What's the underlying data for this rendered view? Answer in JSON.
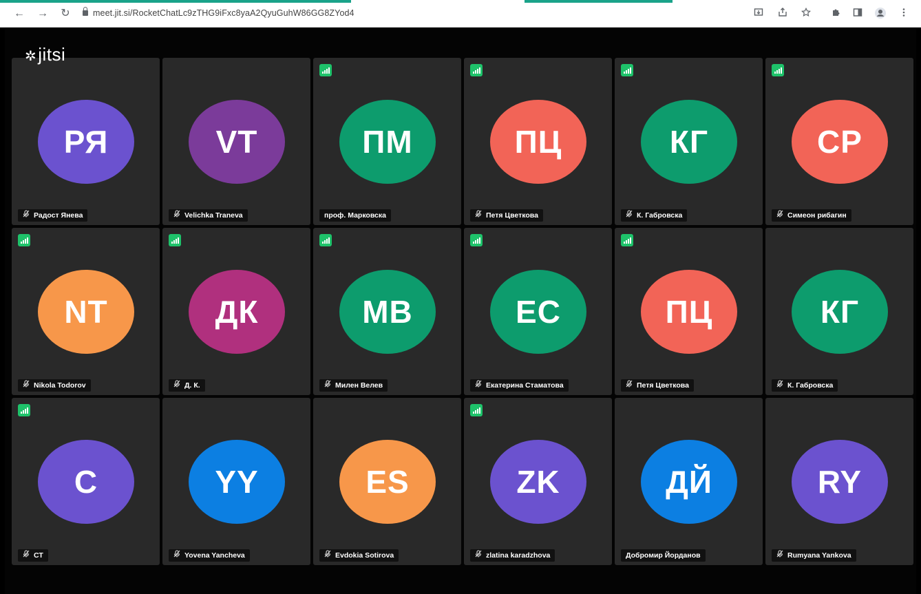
{
  "browser": {
    "url": "meet.jit.si/RocketChatLc9zTHG9iFxc8yaA2QyuGuhW86GG8ZYod4",
    "back_glyph": "←",
    "forward_glyph": "→",
    "reload_glyph": "↻"
  },
  "app": {
    "logo_text": "jitsi"
  },
  "colors": {
    "purple": "#6b52cf",
    "violet": "#7b3b9a",
    "green": "#0d9c6d",
    "coral": "#f26457",
    "orange": "#f7974a",
    "magenta": "#b0307e",
    "blue": "#0c7fe2",
    "connection": "#1ec26a"
  },
  "participants": [
    {
      "initials": "РЯ",
      "name": "Радост Янева",
      "color": "#6b52cf",
      "muted": true,
      "indicator": false
    },
    {
      "initials": "VT",
      "name": "Velichka Traneva",
      "color": "#7b3b9a",
      "muted": true,
      "indicator": false
    },
    {
      "initials": "ПМ",
      "name": "проф. Марковска",
      "color": "#0d9c6d",
      "muted": false,
      "indicator": true
    },
    {
      "initials": "ПЦ",
      "name": "Петя Цветкова",
      "color": "#f26457",
      "muted": true,
      "indicator": true
    },
    {
      "initials": "КГ",
      "name": "К. Габровска",
      "color": "#0d9c6d",
      "muted": true,
      "indicator": true
    },
    {
      "initials": "СР",
      "name": "Симеон рибагин",
      "color": "#f26457",
      "muted": true,
      "indicator": true
    },
    {
      "initials": "NT",
      "name": "Nikola Todorov",
      "color": "#f7974a",
      "muted": true,
      "indicator": true
    },
    {
      "initials": "ДК",
      "name": "Д. К.",
      "color": "#b0307e",
      "muted": true,
      "indicator": true
    },
    {
      "initials": "МВ",
      "name": "Милен Велев",
      "color": "#0d9c6d",
      "muted": true,
      "indicator": true
    },
    {
      "initials": "ЕС",
      "name": "Екатерина Стаматова",
      "color": "#0d9c6d",
      "muted": true,
      "indicator": true
    },
    {
      "initials": "ПЦ",
      "name": "Петя Цветкова",
      "color": "#f26457",
      "muted": true,
      "indicator": true
    },
    {
      "initials": "КГ",
      "name": "К. Габровска",
      "color": "#0d9c6d",
      "muted": true,
      "indicator": false
    },
    {
      "initials": "C",
      "name": "СТ",
      "color": "#6b52cf",
      "muted": true,
      "indicator": true
    },
    {
      "initials": "YY",
      "name": "Yovena Yancheva",
      "color": "#0c7fe2",
      "muted": true,
      "indicator": false
    },
    {
      "initials": "ES",
      "name": "Evdokia Sotirova",
      "color": "#f7974a",
      "muted": true,
      "indicator": false
    },
    {
      "initials": "ZK",
      "name": "zlatina karadzhova",
      "color": "#6b52cf",
      "muted": true,
      "indicator": true
    },
    {
      "initials": "ДЙ",
      "name": "Добромир Йорданов",
      "color": "#0c7fe2",
      "muted": false,
      "indicator": false
    },
    {
      "initials": "RY",
      "name": "Rumyana Yankova",
      "color": "#6b52cf",
      "muted": true,
      "indicator": false
    }
  ]
}
